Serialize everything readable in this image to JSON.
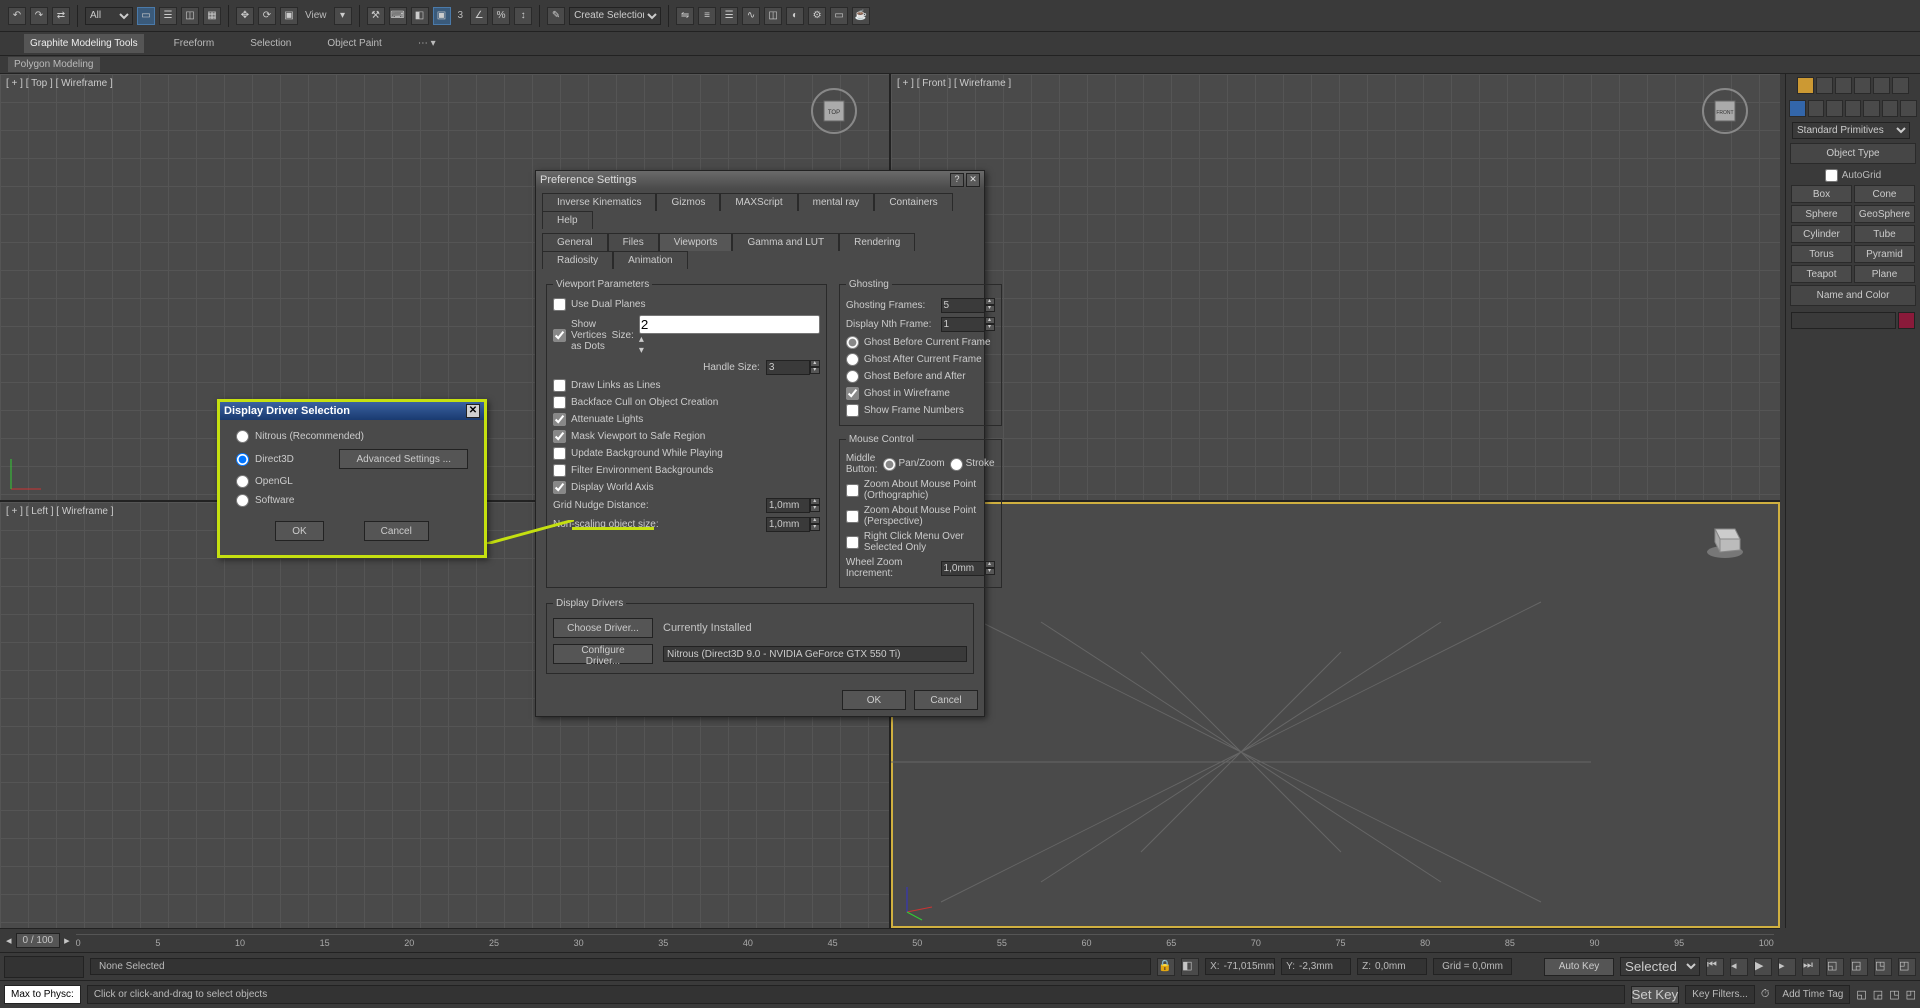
{
  "toolbar": {
    "filter": "All",
    "view_label": "View",
    "num_label": "3",
    "sel_set": "Create Selection Sel"
  },
  "ribbon": {
    "tabs": [
      "Graphite Modeling Tools",
      "Freeform",
      "Selection",
      "Object Paint"
    ],
    "sub": "Polygon Modeling"
  },
  "viewports": {
    "top": "[ + ] [ Top ] [ Wireframe ]",
    "front": "[ + ] [ Front ] [ Wireframe ]",
    "left": "[ + ] [ Left ] [ Wireframe ]",
    "persp": "",
    "cube_top": "TOP",
    "cube_front": "FRONT"
  },
  "cmd": {
    "category": "Standard Primitives",
    "sec_object": "Object Type",
    "autogrid": "AutoGrid",
    "prims": [
      "Box",
      "Cone",
      "Sphere",
      "GeoSphere",
      "Cylinder",
      "Tube",
      "Torus",
      "Pyramid",
      "Teapot",
      "Plane"
    ],
    "sec_color": "Name and Color"
  },
  "timeline": {
    "frame": "0 / 100",
    "ticks": [
      "0",
      "5",
      "10",
      "15",
      "20",
      "25",
      "30",
      "35",
      "40",
      "45",
      "50",
      "55",
      "60",
      "65",
      "70",
      "75",
      "80",
      "85",
      "90",
      "95",
      "100"
    ]
  },
  "status": {
    "sel": "None Selected",
    "x": "-71,015mm",
    "y": "-2,3mm",
    "z": "0,0mm",
    "grid": "Grid = 0,0mm",
    "autokey": "Auto Key",
    "setkey": "Set Key",
    "selected": "Selected",
    "addtag": "Add Time Tag",
    "keyfilters": "Key Filters...",
    "script": "Max to Physc:",
    "prompt": "Click or click-and-drag to select objects"
  },
  "prefs": {
    "title": "Preference Settings",
    "tabs_top": [
      "Inverse Kinematics",
      "Gizmos",
      "MAXScript",
      "mental ray",
      "Containers",
      "Help"
    ],
    "tabs_bot": [
      "General",
      "Files",
      "Viewports",
      "Gamma and LUT",
      "Rendering",
      "Radiosity",
      "Animation"
    ],
    "vp_params": {
      "legend": "Viewport Parameters",
      "use_dual": "Use Dual Planes",
      "show_verts": "Show Vertices as Dots",
      "size_lbl": "Size:",
      "size_val": "2",
      "handle_lbl": "Handle Size:",
      "handle_val": "3",
      "draw_links": "Draw Links as Lines",
      "backface": "Backface Cull on Object Creation",
      "atten": "Attenuate Lights",
      "mask": "Mask Viewport to Safe Region",
      "update_bg": "Update Background While Playing",
      "filter_env": "Filter Environment Backgrounds",
      "world_axis": "Display World Axis",
      "nudge_lbl": "Grid Nudge Distance:",
      "nudge_val": "1,0mm",
      "nonscale_lbl": "Non-scaling object size:",
      "nonscale_val": "1,0mm"
    },
    "ghost": {
      "legend": "Ghosting",
      "frames_lbl": "Ghosting Frames:",
      "frames_val": "5",
      "nth_lbl": "Display Nth Frame:",
      "nth_val": "1",
      "before": "Ghost Before Current Frame",
      "after": "Ghost After Current Frame",
      "both": "Ghost Before and After",
      "wire": "Ghost in Wireframe",
      "numbers": "Show Frame Numbers"
    },
    "mouse": {
      "legend": "Mouse Control",
      "mid_lbl": "Middle Button:",
      "pan": "Pan/Zoom",
      "stroke": "Stroke",
      "zoom_ortho": "Zoom About Mouse Point (Orthographic)",
      "zoom_persp": "Zoom About Mouse Point (Perspective)",
      "rclick": "Right Click Menu Over Selected Only",
      "wheel_lbl": "Wheel Zoom Increment:",
      "wheel_val": "1,0mm"
    },
    "drv": {
      "legend": "Display Drivers",
      "choose": "Choose Driver...",
      "config": "Configure Driver...",
      "curr_lbl": "Currently Installed",
      "curr_val": "Nitrous (Direct3D 9.0 - NVIDIA GeForce GTX 550 Ti)"
    },
    "ok": "OK",
    "cancel": "Cancel"
  },
  "drvdlg": {
    "title": "Display Driver Selection",
    "nitrous": "Nitrous (Recommended)",
    "d3d": "Direct3D",
    "ogl": "OpenGL",
    "sw": "Software",
    "adv": "Advanced Settings ...",
    "ok": "OK",
    "cancel": "Cancel"
  }
}
